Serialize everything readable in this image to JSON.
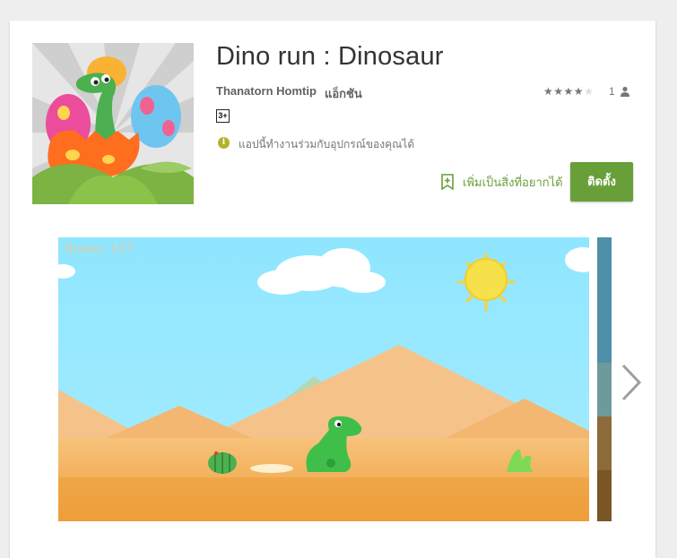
{
  "app": {
    "title": "Dino run : Dinosaur",
    "developer": "Thanatorn Homtip",
    "genre": "แอ็กชัน",
    "content_rating": "3+",
    "compatibility": "แอปนี้ทำงานร่วมกับอุปกรณ์ของคุณได้",
    "rating_stars": 4,
    "rating_count": "1"
  },
  "actions": {
    "wishlist_label": "เพิ่มเป็นสิ่งที่อยากได้",
    "install_label": "ติดตั้ง"
  },
  "screenshot": {
    "score_text": "Score: 157"
  },
  "icons": {
    "compat": "info-icon",
    "person": "person-icon",
    "wishlist": "bookmark-plus-icon",
    "next": "chevron-right-icon"
  },
  "colors": {
    "accent_green": "#689f38",
    "compat_icon": "#afb42b",
    "sky": "#8fe6ff",
    "sand": "#f3b35c"
  }
}
